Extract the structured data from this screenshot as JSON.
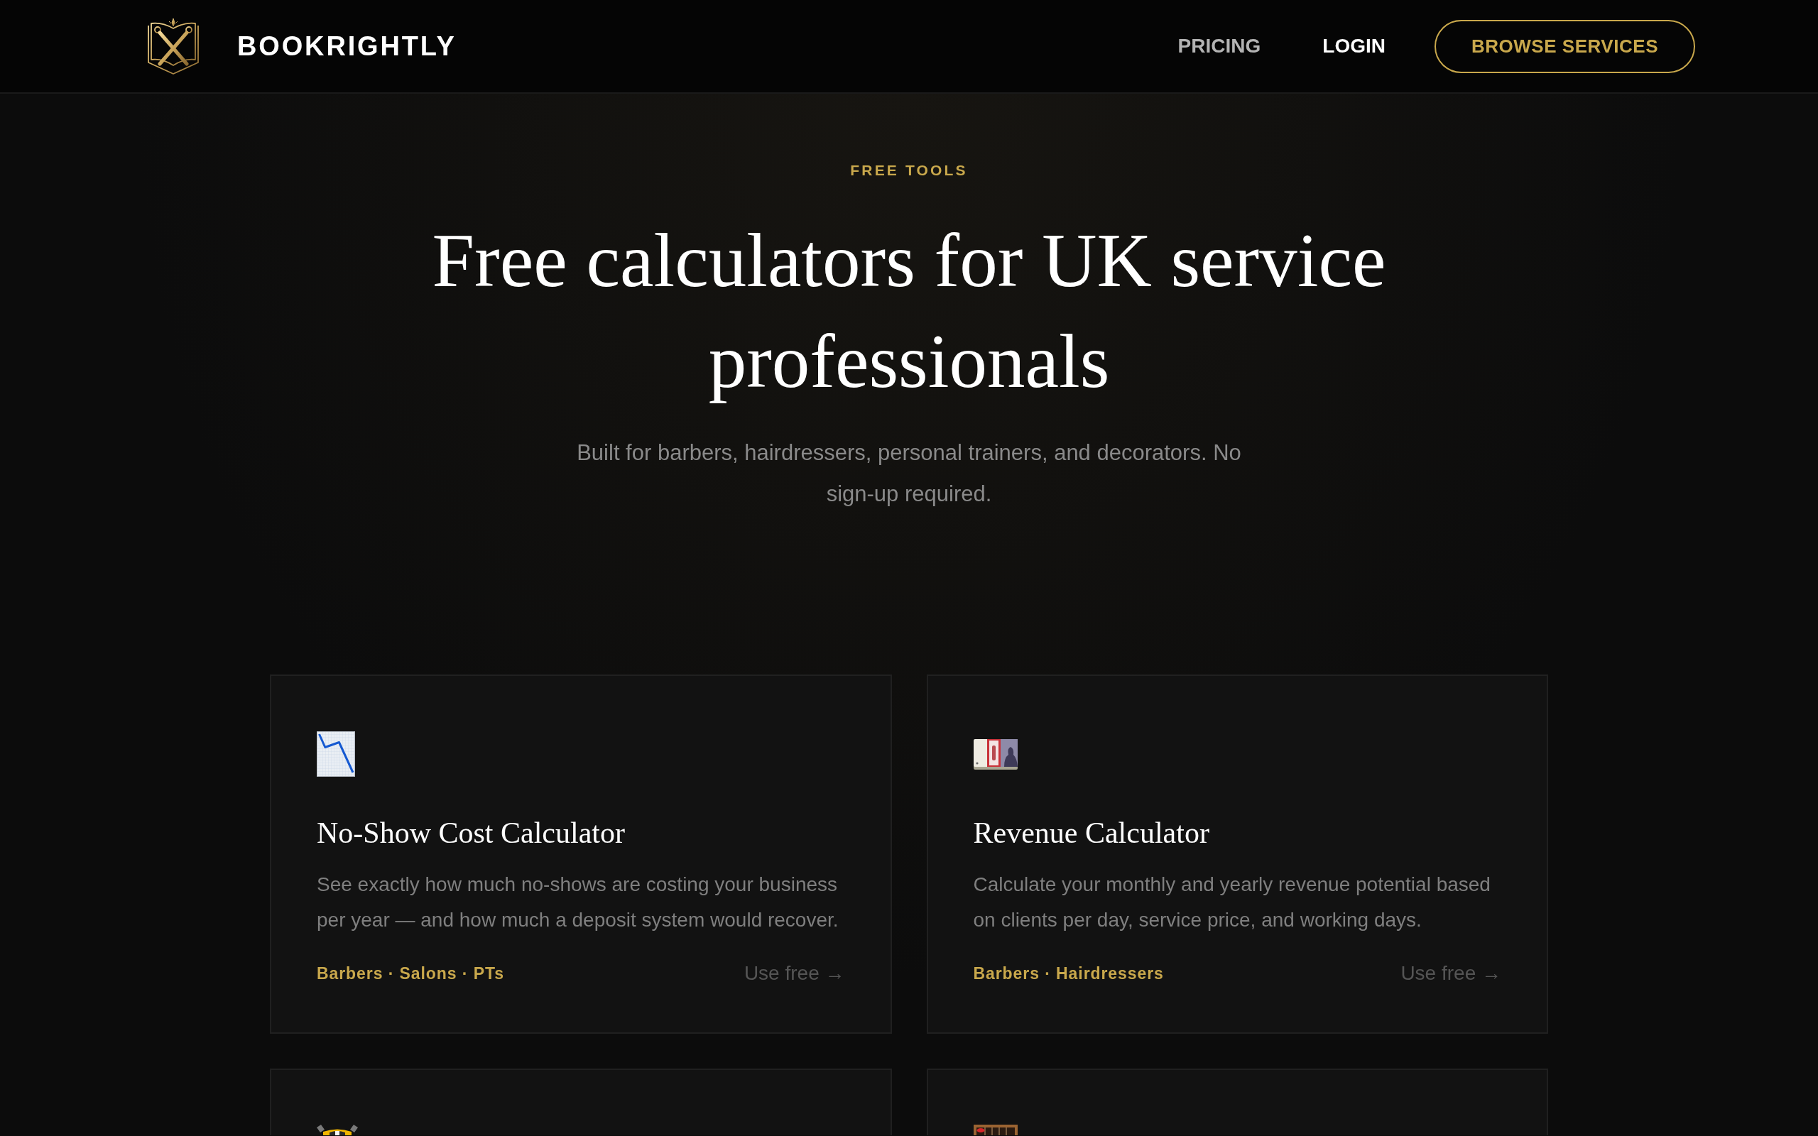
{
  "header": {
    "brand": "BOOKRIGHTLY",
    "nav": [
      {
        "label": "PRICING",
        "highlighted": false
      },
      {
        "label": "LOGIN",
        "highlighted": true
      }
    ],
    "cta": "BROWSE SERVICES"
  },
  "hero": {
    "eyebrow": "FREE TOOLS",
    "title": "Free calculators for UK service professionals",
    "subtitle": "Built for barbers, hairdressers, personal trainers, and decorators. No sign-up required."
  },
  "tools": [
    {
      "kind": "full",
      "title": "No-Show Cost Calculator",
      "description": "See exactly how much no-shows are costing your business per year — and how much a deposit system would recover.",
      "tags": "Barbers · Salons · PTs",
      "link": "Use free →"
    },
    {
      "kind": "full",
      "title": "Revenue Calculator",
      "description": "Calculate your monthly and yearly revenue potential based on clients per day, service price, and working days.",
      "tags": "Barbers · Hairdressers",
      "link": "Use free →"
    },
    {
      "kind": "clipped"
    },
    {
      "kind": "clipped"
    }
  ]
}
